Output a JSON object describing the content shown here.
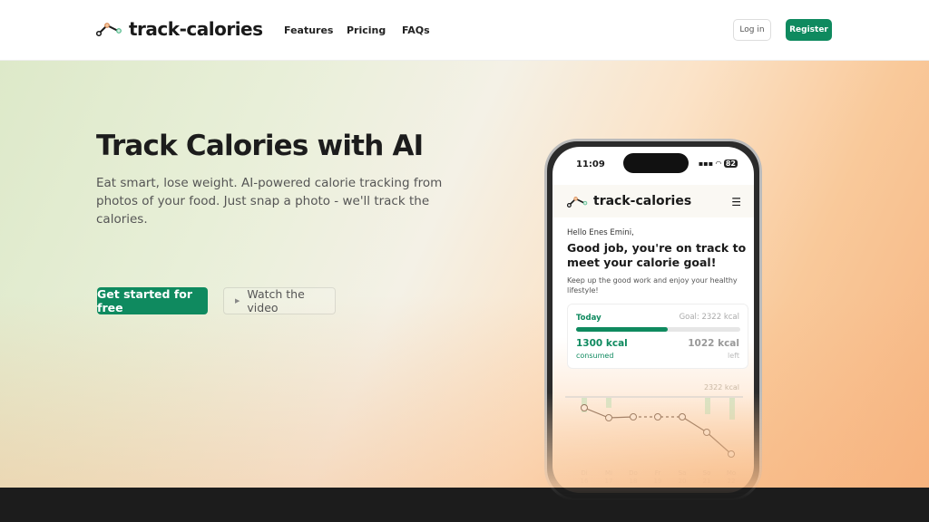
{
  "nav": {
    "brand": "track-calories",
    "links": [
      "Features",
      "Pricing",
      "FAQs"
    ],
    "login": "Log in",
    "register": "Register"
  },
  "hero": {
    "title": "Track Calories with AI",
    "subtitle": "Eat smart, lose weight. AI-powered calorie tracking from photos of your food. Just snap a photo - we'll track the calories.",
    "cta": "Get started for free",
    "watch": "Watch the video"
  },
  "phone": {
    "time": "11:09",
    "battery": "82",
    "brand": "track-calories",
    "greeting": "Hello Enes Emini,",
    "headline": "Good job, you're on track to meet your calorie goal!",
    "message": "Keep up the good work and enjoy your healthy lifestyle!",
    "card": {
      "label": "Today",
      "goal": "Goal: 2322 kcal",
      "progress": 0.56,
      "consumed": "1300 kcal",
      "consumed_label": "consumed",
      "left": "1022 kcal",
      "left_label": "left"
    },
    "chart": {
      "goal_label": "2322 kcal",
      "days": [
        [
          "Di",
          "16"
        ],
        [
          "Mi",
          "17"
        ],
        [
          "Do",
          "18"
        ],
        [
          "Fr",
          "19"
        ],
        [
          "Sa",
          "20"
        ],
        [
          "So",
          "21"
        ],
        [
          "Mo",
          "22"
        ]
      ]
    }
  },
  "colors": {
    "accent": "#0f8a5f",
    "footer": "#1c1c1c"
  }
}
